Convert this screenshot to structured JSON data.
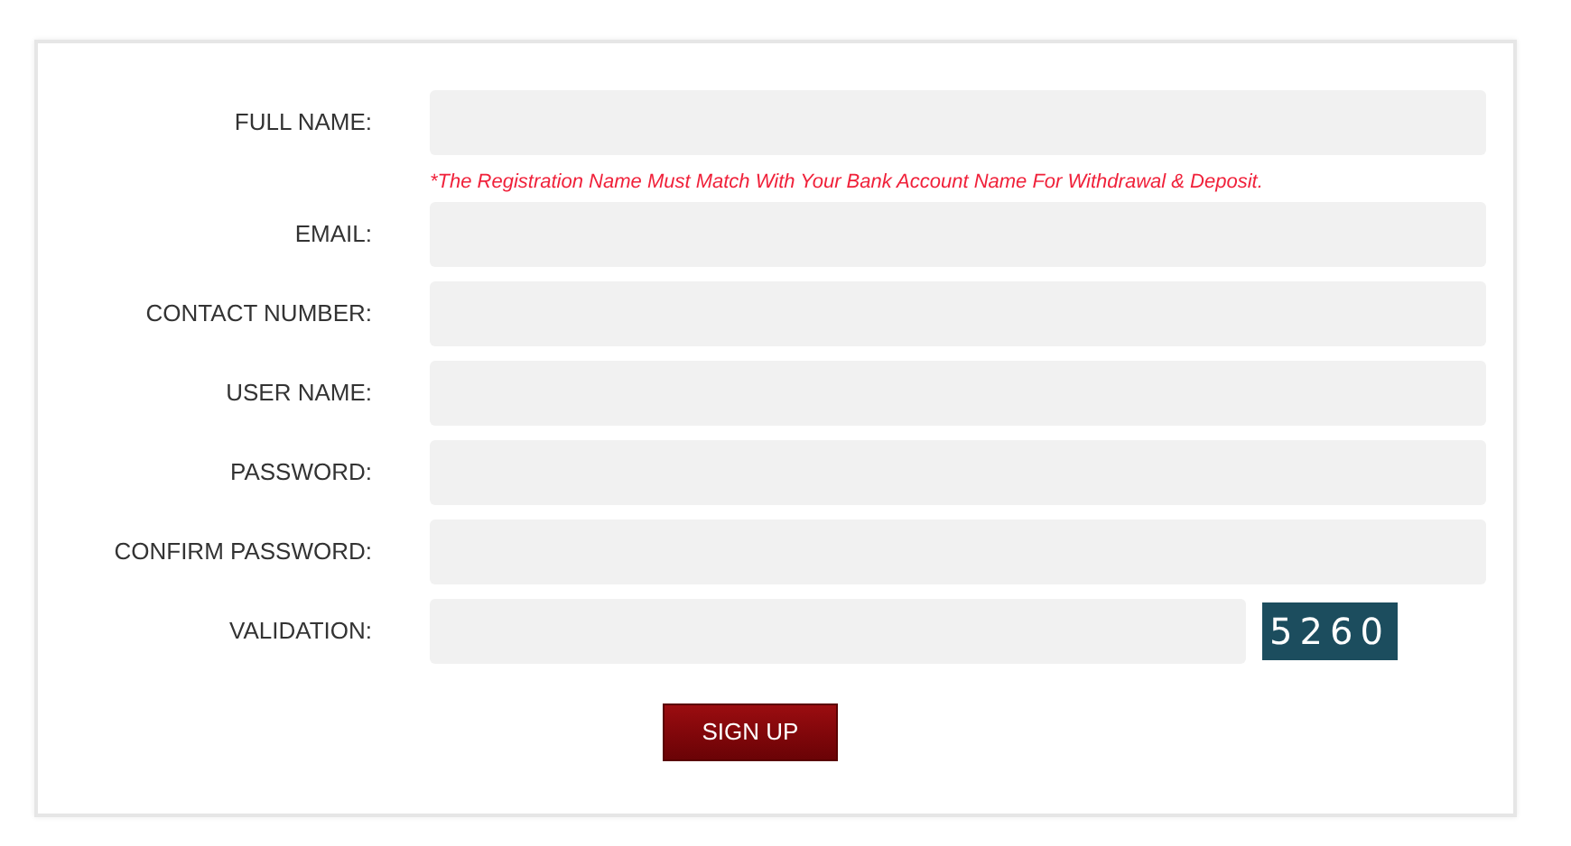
{
  "fields": [
    {
      "label": "FULL NAME:",
      "note": "*The Registration Name Must Match With Your Bank Account Name For Withdrawal & Deposit."
    },
    {
      "label": "EMAIL:"
    },
    {
      "label": "CONTACT NUMBER:"
    },
    {
      "label": "USER NAME:"
    },
    {
      "label": "PASSWORD:"
    },
    {
      "label": "CONFIRM PASSWORD:"
    },
    {
      "label": "VALIDATION:",
      "kind": "captcha",
      "captcha": "5260"
    }
  ],
  "button": "SIGN UP"
}
